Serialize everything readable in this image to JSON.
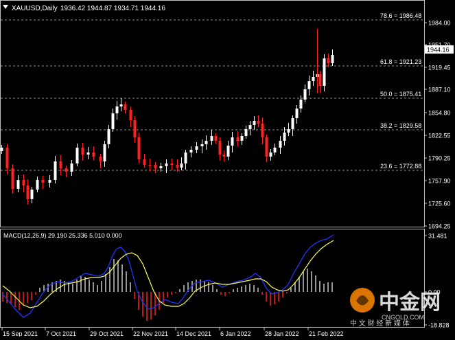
{
  "colors": {
    "background": "#000000",
    "bull": "#ffffff",
    "bear": "#ff2020",
    "grid": "#c0c0c0",
    "text": "#ffffff",
    "macd_line": "#2233ff",
    "signal_line": "#ffff55",
    "hist_pos": "#c8c8c8",
    "hist_neg": "#ff2020",
    "price_tag_bg": "#ffffff",
    "price_tag_text": "#000000",
    "watermark_orange": "#ff8a00"
  },
  "header": {
    "symbol": "XAUUSD,Daily",
    "ohlc": "1936.42 1944.87 1934.71 1944.16"
  },
  "price_axis": {
    "ticks": [
      "1984.00",
      "1951.70",
      "1919.45",
      "1887.10",
      "1854.80",
      "1822.55",
      "1790.25",
      "1757.90",
      "1725.60",
      "1694.25"
    ],
    "current_price": "1944.16"
  },
  "fibonacci_levels": [
    {
      "label": "78.6 = 1986.48"
    },
    {
      "label": "61.8 = 1921.23"
    },
    {
      "label": "50.0 = 1875.41"
    },
    {
      "label": "38.2 = 1829.58"
    },
    {
      "label": "23.6 = 1772.88"
    }
  ],
  "macd": {
    "header": "MACD(12,26,9) 29.190 25.336 5.010 0.000",
    "ticks": [
      "31.481",
      "0.00",
      "-18.828"
    ]
  },
  "time_axis": {
    "labels": [
      "15 Sep 2021",
      "7 Oct 2021",
      "29 Oct 2021",
      "22 Nov 2021",
      "14 Dec 2021",
      "6 Jan 2022",
      "28 Jan 2022",
      "21 Feb 2022"
    ]
  },
  "watermark": {
    "name": "中金网",
    "domain": "CNGOLD.COM",
    "tagline": "中 文 财 经 新 媒 体"
  }
}
